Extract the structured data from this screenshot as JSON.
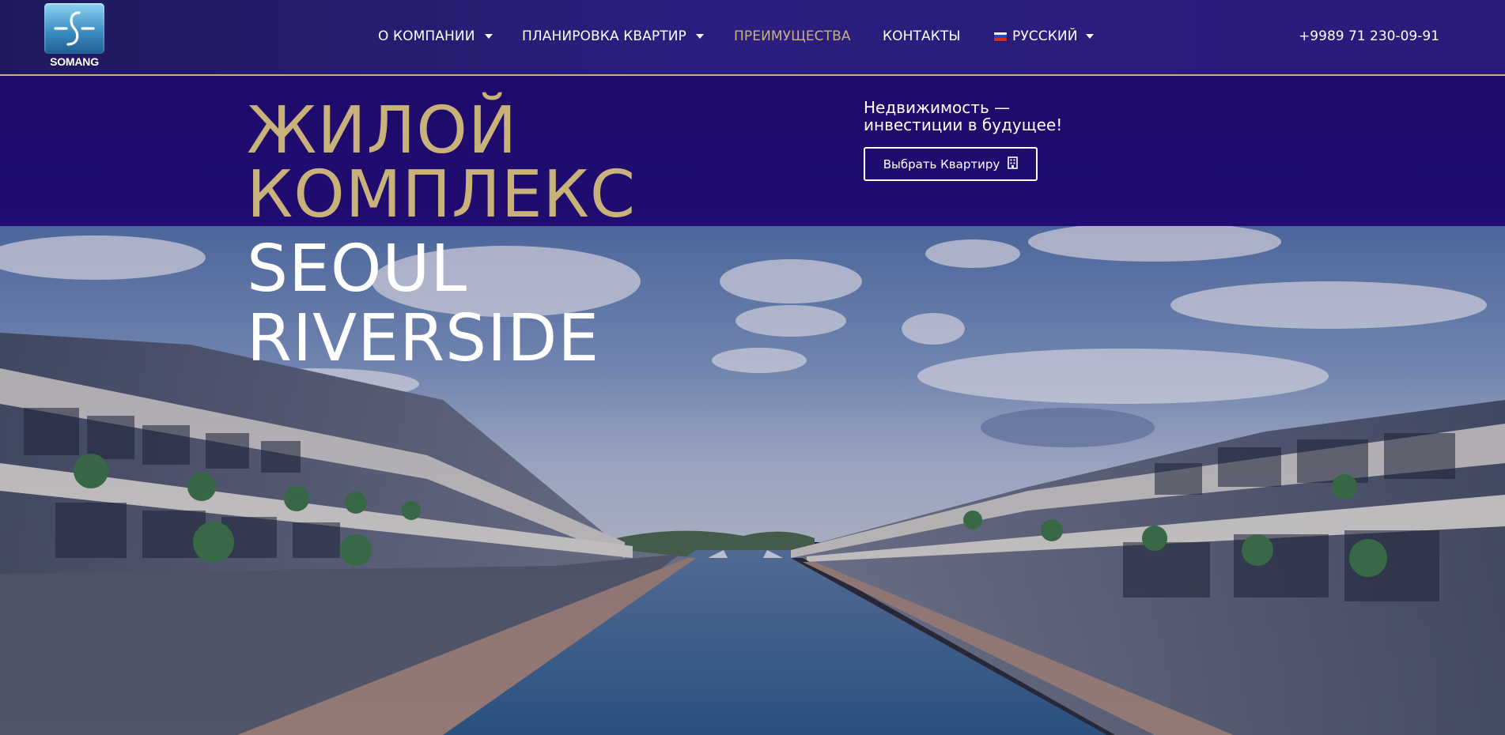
{
  "header": {
    "logo_text": "SOMANG",
    "nav": [
      {
        "label": "О КОМПАНИИ",
        "has_dropdown": true,
        "active": false
      },
      {
        "label": "ПЛАНИРОВКА КВАРТИР",
        "has_dropdown": true,
        "active": false
      },
      {
        "label": "ПРЕИМУЩЕСТВА",
        "has_dropdown": false,
        "active": true
      },
      {
        "label": "КОНТАКТЫ",
        "has_dropdown": false,
        "active": false
      }
    ],
    "language": {
      "label": "РУССКИЙ",
      "flag_icon": "russia-flag-icon"
    },
    "phone": "+9989 71 230-09-91"
  },
  "hero": {
    "title_line_1": "ЖИЛОЙ",
    "title_line_2": "КОМПЛЕКС",
    "title_line_3": "SEOUL",
    "title_line_4": "RIVERSIDE",
    "tagline_line_1": "Недвижимость —",
    "tagline_line_2": "инвестиции в будущее!",
    "cta_label": "Выбрать Квартиру",
    "cta_icon": "building-icon"
  },
  "colors": {
    "accent_gold": "#c9b27a",
    "header_bg": "#2a1f7e",
    "band_bg": "#1e0b6a",
    "text_white": "#ffffff"
  }
}
